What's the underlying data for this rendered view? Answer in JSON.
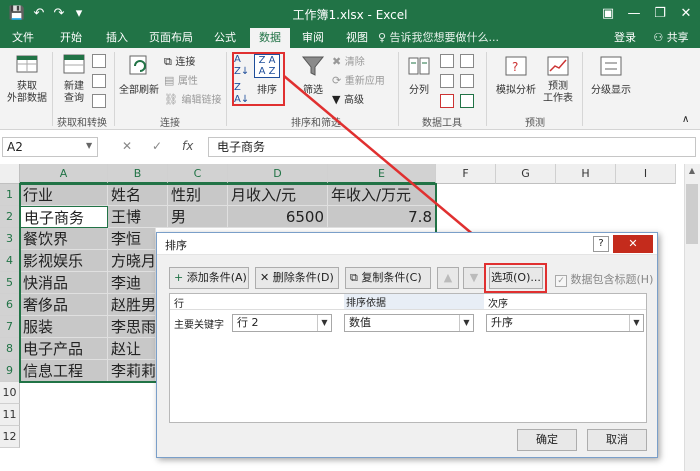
{
  "window": {
    "title": "工作簿1.xlsx - Excel",
    "min": "—",
    "restore": "❐",
    "close": "✕",
    "ribbon_display": "▣"
  },
  "quick_access": {
    "save": "💾",
    "undo": "↶",
    "redo": "↷",
    "customize": "▾"
  },
  "tabs": [
    {
      "label": "文件"
    },
    {
      "label": "开始"
    },
    {
      "label": "插入"
    },
    {
      "label": "页面布局"
    },
    {
      "label": "公式"
    },
    {
      "label": "数据"
    },
    {
      "label": "审阅"
    },
    {
      "label": "视图"
    }
  ],
  "tell_me": "♀ 告诉我您想要做什么...",
  "account": {
    "login": "登录",
    "share": "共享"
  },
  "ribbon": {
    "get_data": "获取\n外部数据",
    "new_query": "新建\n查询",
    "refresh_all": "全部刷新",
    "connections": "连接",
    "properties": "属性",
    "edit_links": "编辑链接",
    "sort": "排序",
    "filter": "筛选",
    "clear": "清除",
    "reapply": "重新应用",
    "advanced": "高级",
    "split": "分列",
    "whatif": "模拟分析",
    "forecast": "预测\n工作表",
    "outline": "分级显示",
    "groups": {
      "get_transform": "获取和转换",
      "connections": "连接",
      "sort_filter": "排序和筛选",
      "data_tools": "数据工具",
      "forecast": "预测"
    }
  },
  "formula_bar": {
    "cell_ref": "A2",
    "value": "电子商务",
    "fx": "fx"
  },
  "grid": {
    "columns": [
      "A",
      "B",
      "C",
      "D",
      "E",
      "F",
      "G",
      "H",
      "I"
    ],
    "rows": [
      "1",
      "2",
      "3",
      "4",
      "5",
      "6",
      "7",
      "8",
      "9",
      "10",
      "11",
      "12"
    ],
    "data": [
      [
        "行业",
        "姓名",
        "性别",
        "月收入/元",
        "年收入/万元"
      ],
      [
        "电子商务",
        "王博",
        "男",
        "6500",
        "7.8"
      ],
      [
        "餐饮界",
        "李恒",
        "",
        "",
        ""
      ],
      [
        "影视娱乐",
        "方晓月",
        "",
        "",
        ""
      ],
      [
        "快消品",
        "李迪",
        "",
        "",
        ""
      ],
      [
        "奢侈品",
        "赵胜男",
        "",
        "",
        ""
      ],
      [
        "服装",
        "李思雨",
        "",
        "",
        ""
      ],
      [
        "电子产品",
        "赵让",
        "",
        "",
        ""
      ],
      [
        "信息工程",
        "李莉莉",
        "",
        "",
        ""
      ]
    ]
  },
  "dialog": {
    "title": "排序",
    "help": "?",
    "close": "✕",
    "add_level": "添加条件(A)",
    "delete_level": "删除条件(D)",
    "copy_level": "复制条件(C)",
    "up": "▲",
    "down": "▼",
    "options": "选项(O)...",
    "has_headers": "数据包含标题(H)",
    "col_header_row": "行",
    "col_header_sorton": "排序依据",
    "col_header_order": "次序",
    "primary_key": "主要关键字",
    "key_value": "行 2",
    "sort_on_value": "数值",
    "order_value": "升序",
    "ok": "确定",
    "cancel": "取消"
  },
  "colors": {
    "excel_green": "#217346",
    "highlight_red": "#e03030"
  }
}
